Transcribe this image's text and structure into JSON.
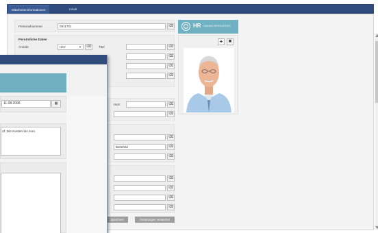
{
  "tabs": [
    {
      "label": "Mitarbeiterinformationen",
      "active": true
    },
    {
      "label": "Inhalt",
      "active": false
    }
  ],
  "personalnummer": {
    "label": "Personalnummer",
    "value": "0911701"
  },
  "personal_data": {
    "heading": "Persönliche Daten",
    "anrede_label": "Anrede",
    "anrede_value": "Herr",
    "titel_label": "Titel"
  },
  "hr_card": {
    "title": "HR",
    "subtitle": "HUMAN RESOURCES",
    "add_label": "+",
    "remove_label": "✖"
  },
  "address": {
    "ort_label": "rsort",
    "city_value": "Bielefeld"
  },
  "buttons": {
    "save": "Speichern",
    "discard": "Änderungen verwerfen"
  },
  "dialog": {
    "date_value": "11.08.2006",
    "note_text": "of. Die Kosten bis zum"
  },
  "icons": {
    "clear": "⌫",
    "calendar": "▦",
    "dropdown": "▼"
  },
  "colors": {
    "nav": "#2f4b7c",
    "accent": "#6fb0c2"
  }
}
